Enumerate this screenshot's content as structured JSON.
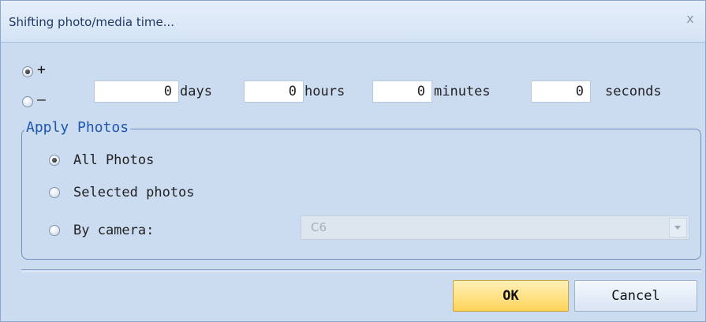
{
  "dialog": {
    "title": "Shifting photo/media time...",
    "close_glyph": "x"
  },
  "shift": {
    "sign_plus_label": "+",
    "sign_minus_label": "–",
    "sign_selected": "+",
    "days_value": "0",
    "days_label": "days",
    "hours_value": "0",
    "hours_label": "hours",
    "minutes_value": "0",
    "minutes_label": "minutes",
    "seconds_value": "0",
    "seconds_label": "seconds"
  },
  "apply_photos": {
    "group_title": "Apply Photos",
    "option_all": "All Photos",
    "option_selected": "Selected photos",
    "option_camera": "By camera:",
    "selected_option": "All Photos",
    "camera_value": "C6",
    "camera_combo_enabled": false
  },
  "buttons": {
    "ok_label": "OK",
    "cancel_label": "Cancel"
  },
  "colors": {
    "ok_button": "#ffd35a",
    "group_title": "#1d55b0",
    "dialog_background": "#cbdcf1"
  }
}
